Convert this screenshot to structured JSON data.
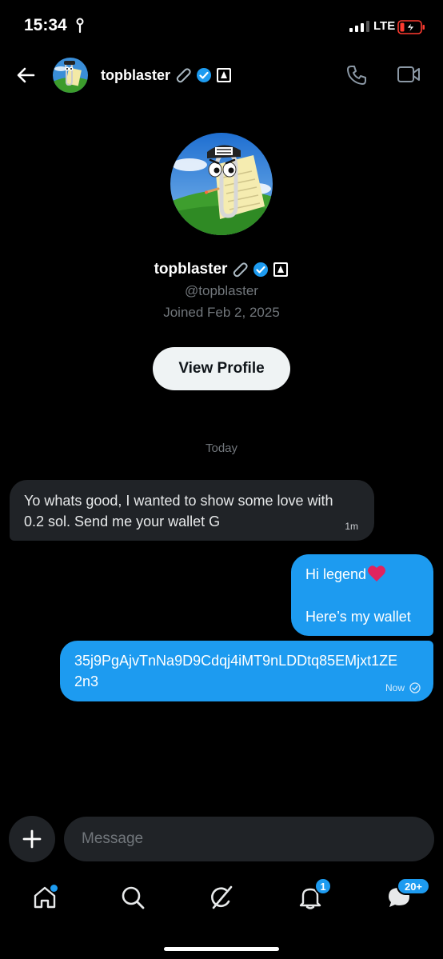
{
  "status_bar": {
    "time": "15:34",
    "network": "LTE"
  },
  "header": {
    "name": "topblaster"
  },
  "profile": {
    "name": "topblaster",
    "handle": "@topblaster",
    "joined": "Joined Feb 2, 2025",
    "view_profile_label": "View Profile"
  },
  "date_divider": "Today",
  "messages": [
    {
      "direction": "incoming",
      "line1": "Yo whats good, I wanted to show some love with",
      "line2": "0.2 sol. Send me your wallet G",
      "timestamp": "1m"
    },
    {
      "direction": "outgoing",
      "line1": "Hi legend",
      "line2": "Here’s my wallet"
    },
    {
      "direction": "outgoing",
      "line1": "35j9PgAjvTnNa9D9Cdqj4iMT9nLDDtq85EMjxt1ZE",
      "line2": "2n3",
      "timestamp": "Now"
    }
  ],
  "composer": {
    "placeholder": "Message"
  },
  "nav": {
    "notifications_badge": "1",
    "messages_badge": "20+"
  },
  "colors": {
    "accent": "#1d9bf0",
    "incoming_bubble": "#202327",
    "background": "#000000"
  },
  "icons": [
    "back-arrow-icon",
    "paperclip-icon",
    "verified-badge-icon",
    "affiliate-badge-icon",
    "phone-icon",
    "video-icon",
    "plus-icon",
    "home-icon",
    "search-icon",
    "grok-icon",
    "bell-icon",
    "messages-icon",
    "heart-icon",
    "check-circle-icon"
  ]
}
